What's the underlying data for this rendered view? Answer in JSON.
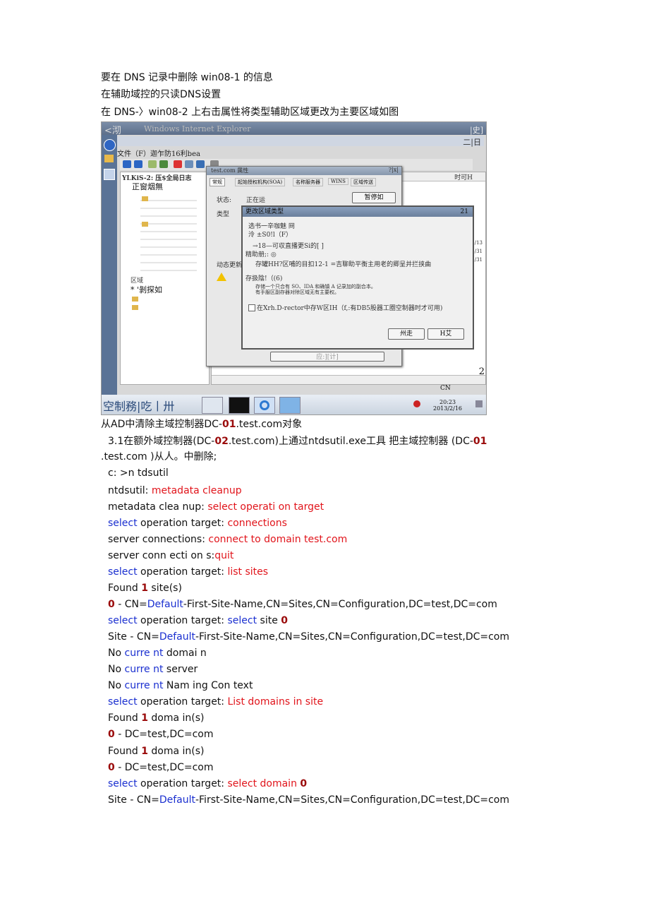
{
  "intro": {
    "line1": "要在 DNS 记录中删除 win08-1 的信息",
    "line2": "在辅助域控的只读DNS设置",
    "line3": "在 DNS-〉win08-2 上右击属性将类型辅助区域更改为主要区域如图"
  },
  "screenshot": {
    "title_left": "<沏",
    "title_center": "Windows Internet Explorer",
    "title_right": "|史]",
    "menu": "文件（F）迦乍防16利bea",
    "tree_header": "YLKiS-2: 压$全局日志",
    "tree_item1": "正窗烟無",
    "tree_item2": "区域",
    "tree_item3": "*  '剝探如",
    "main_col": "时可H",
    "prop_title": "test.com 属性",
    "prop_close": "?|x|",
    "prop_tabs": [
      "常规",
      "起始授权机构(SOA)",
      "名称服务器",
      "WINS",
      "区域传送"
    ],
    "prop_status_label": "状态:",
    "prop_status_value": "正在运",
    "prop_pause": "暂停如",
    "prop_type_label": "类型",
    "prop_dyn_label": "动态更新",
    "prop_bottom_button": "应:][计]",
    "dialog_title": "更改区域类型",
    "dialog_close": "21",
    "dialog_line1": "选书一辛咖魅 冏",
    "dialog_line2": "泠 ±S0!l（F）",
    "dialog_line3": "→18—可収直播更Si的[ ]",
    "dialog_line4": "精助册;: ◎",
    "dialog_line5": "存罐HH?区哺的目扣12-1 =吉聊助平衡主用老的卿呈并拦挟曲",
    "dialog_line6": "存扱陰!（(6)",
    "dialog_line7": "存储一个只合有 SO、IDA 和确镇 A 记录加的副合本。",
    "dialog_line8": "有手服区副存器对除区域无有主要权。",
    "dialog_checkbox": "在Xrh.D-rector中存W区IH（f,:有DB5股器工圈空制器时才可用)",
    "dialog_ok": "州走",
    "dialog_cancel": "H艾",
    "taskbar_label": "空制務|吃丨卅",
    "tray_time": "20:23",
    "tray_date": "2013/2/16",
    "corner_cn": "CN",
    "corner_num": "2"
  },
  "para": {
    "heading_prefix": "从AD中清除主域控制器DC-",
    "heading_num": "01",
    "heading_suffix": ".test.com对象",
    "p1_a": "3.1在额外域控制器(DC-",
    "p1_b": "02",
    "p1_c": ".test.com)上通过ntdsutil.exe工具  把主域控制器  (DC-",
    "p1_d": "01",
    "p2": ".test.com )从人。中删除;"
  },
  "commands": [
    {
      "parts": [
        {
          "t": "c: >n tdsutil",
          "c": ""
        }
      ]
    },
    {
      "parts": [
        {
          "t": "ntdsutil: ",
          "c": ""
        },
        {
          "t": "metadata cleanup",
          "c": "red"
        }
      ]
    },
    {
      "parts": [
        {
          "t": "metadata clea nup: ",
          "c": ""
        },
        {
          "t": "select operati on target",
          "c": "red"
        }
      ]
    },
    {
      "parts": [
        {
          "t": "select",
          "c": "blue"
        },
        {
          "t": " operation target: ",
          "c": ""
        },
        {
          "t": "connections",
          "c": "red"
        }
      ]
    },
    {
      "parts": [
        {
          "t": "server connections: ",
          "c": ""
        },
        {
          "t": "connect to domain test.com",
          "c": "red"
        }
      ]
    },
    {
      "parts": [
        {
          "t": "server conn ecti on s:",
          "c": ""
        },
        {
          "t": "quit",
          "c": "red"
        }
      ]
    },
    {
      "parts": [
        {
          "t": "select",
          "c": "blue"
        },
        {
          "t": " operation target: ",
          "c": ""
        },
        {
          "t": "list sites",
          "c": "red"
        }
      ]
    },
    {
      "parts": [
        {
          "t": "Found ",
          "c": ""
        },
        {
          "t": "1",
          "c": "dred"
        },
        {
          "t": " site(s)",
          "c": ""
        }
      ]
    },
    {
      "parts": [
        {
          "t": "0",
          "c": "dred"
        },
        {
          "t": " - CN=",
          "c": ""
        },
        {
          "t": "Default",
          "c": "blue"
        },
        {
          "t": "-First-Site-Name,CN=Sites,CN=Configuration,DC=test,DC=com",
          "c": ""
        }
      ]
    },
    {
      "parts": [
        {
          "t": "select",
          "c": "blue"
        },
        {
          "t": " operation target: ",
          "c": ""
        },
        {
          "t": "select",
          "c": "blue"
        },
        {
          "t": " site ",
          "c": ""
        },
        {
          "t": "0",
          "c": "dred"
        }
      ]
    },
    {
      "parts": [
        {
          "t": "Site - CN=",
          "c": ""
        },
        {
          "t": "Default",
          "c": "blue"
        },
        {
          "t": "-First-Site-Name,CN=Sites,CN=Configuration,DC=test,DC=com",
          "c": ""
        }
      ]
    },
    {
      "parts": [
        {
          "t": "No ",
          "c": ""
        },
        {
          "t": "curre nt",
          "c": "blue"
        },
        {
          "t": " domai n",
          "c": ""
        }
      ]
    },
    {
      "parts": [
        {
          "t": "No ",
          "c": ""
        },
        {
          "t": "curre nt",
          "c": "blue"
        },
        {
          "t": " server",
          "c": ""
        }
      ]
    },
    {
      "parts": [
        {
          "t": "No ",
          "c": ""
        },
        {
          "t": "curre nt",
          "c": "blue"
        },
        {
          "t": " Nam ing Con text",
          "c": ""
        }
      ]
    },
    {
      "parts": [
        {
          "t": "select",
          "c": "blue"
        },
        {
          "t": " operation target: ",
          "c": ""
        },
        {
          "t": "List domains in site",
          "c": "red"
        }
      ]
    },
    {
      "parts": [
        {
          "t": "Found ",
          "c": ""
        },
        {
          "t": "1",
          "c": "dred"
        },
        {
          "t": " doma in(s)",
          "c": ""
        }
      ]
    },
    {
      "parts": [
        {
          "t": "0",
          "c": "dred"
        },
        {
          "t": " - DC=test,DC=com",
          "c": ""
        }
      ]
    },
    {
      "parts": [
        {
          "t": "Found ",
          "c": ""
        },
        {
          "t": "1",
          "c": "dred"
        },
        {
          "t": " doma in(s)",
          "c": ""
        }
      ]
    },
    {
      "parts": [
        {
          "t": "0",
          "c": "dred"
        },
        {
          "t": " - DC=test,DC=com",
          "c": ""
        }
      ]
    },
    {
      "parts": [
        {
          "t": "select",
          "c": "blue"
        },
        {
          "t": " operation target: ",
          "c": ""
        },
        {
          "t": "select domain ",
          "c": "red"
        },
        {
          "t": "0",
          "c": "dred"
        }
      ]
    },
    {
      "parts": [
        {
          "t": "Site - CN=",
          "c": ""
        },
        {
          "t": "Default",
          "c": "blue"
        },
        {
          "t": "-First-Site-Name,CN=Sites,CN=Configuration,DC=test,DC=com",
          "c": ""
        }
      ]
    }
  ],
  "colors": {
    "red": "#e1141b",
    "blue": "#1a2fd0",
    "dark_red": "#9a0a0a"
  }
}
